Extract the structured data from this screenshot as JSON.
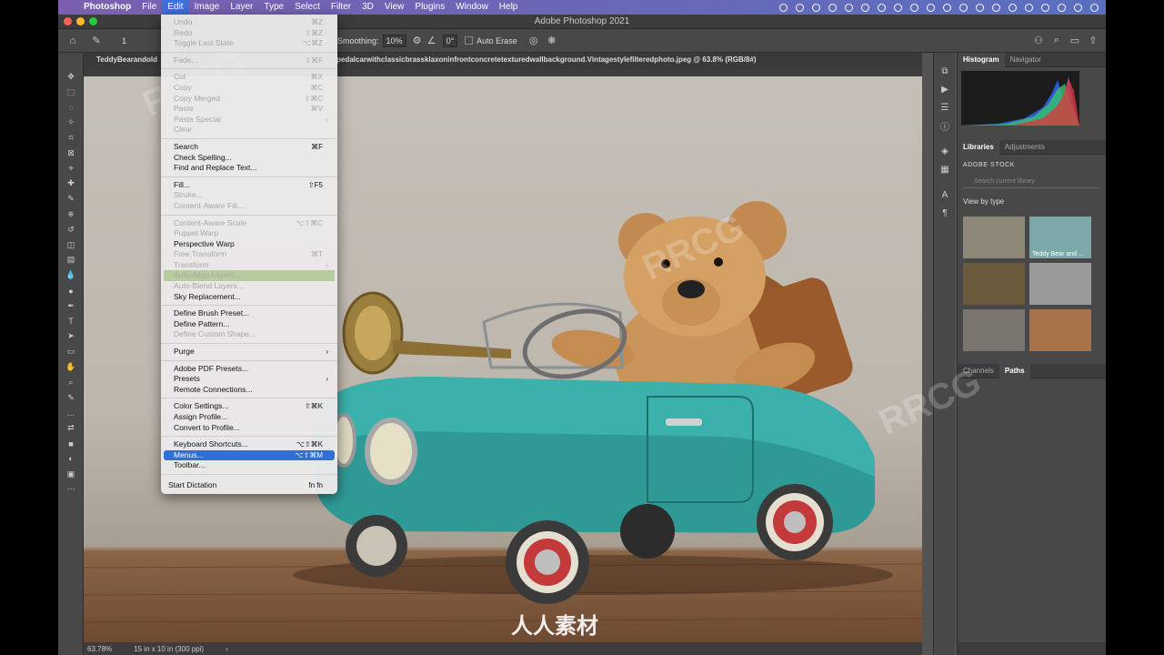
{
  "menubar": {
    "app": "Photoshop",
    "items": [
      "File",
      "Edit",
      "Image",
      "Layer",
      "Type",
      "Select",
      "Filter",
      "3D",
      "View",
      "Plugins",
      "Window",
      "Help"
    ],
    "active": "Edit"
  },
  "window": {
    "title": "Adobe Photoshop 2021"
  },
  "options": {
    "brush_size": "1",
    "smoothing_label": "Smoothing:",
    "smoothing_value": "10%",
    "angle": "0°",
    "auto_erase": "Auto Erase"
  },
  "document": {
    "tab_left": "TeddyBearandold",
    "tab_right": "pedalcarwithclassicbrassklaxoninfrontconcretetexturedwallbackground.Vintagestylefilteredphoto.jpeg @ 63.8% (RGB/8#)"
  },
  "status": {
    "zoom": "63.78%",
    "size": "15 in x 10 in (300 ppi)",
    "arrow": "›"
  },
  "edit_menu": [
    {
      "label": "Undo",
      "shortcut": "⌘Z",
      "disabled": true
    },
    {
      "label": "Redo",
      "shortcut": "⇧⌘Z",
      "disabled": true
    },
    {
      "label": "Toggle Last State",
      "shortcut": "⌥⌘Z",
      "disabled": true
    },
    {
      "sep": true
    },
    {
      "label": "Fade...",
      "shortcut": "⇧⌘F",
      "disabled": true
    },
    {
      "sep": true
    },
    {
      "label": "Cut",
      "shortcut": "⌘X",
      "disabled": true
    },
    {
      "label": "Copy",
      "shortcut": "⌘C",
      "disabled": true
    },
    {
      "label": "Copy Merged",
      "shortcut": "⇧⌘C",
      "disabled": true
    },
    {
      "label": "Paste",
      "shortcut": "⌘V",
      "disabled": true
    },
    {
      "label": "Paste Special",
      "shortcut": "›",
      "disabled": true,
      "sub": true
    },
    {
      "label": "Clear",
      "shortcut": "",
      "disabled": true
    },
    {
      "sep": true
    },
    {
      "label": "Search",
      "shortcut": "⌘F"
    },
    {
      "label": "Check Spelling...",
      "shortcut": ""
    },
    {
      "label": "Find and Replace Text...",
      "shortcut": ""
    },
    {
      "sep": true
    },
    {
      "label": "Fill...",
      "shortcut": "⇧F5"
    },
    {
      "label": "Stroke...",
      "shortcut": "",
      "disabled": true
    },
    {
      "label": "Content-Aware Fill...",
      "shortcut": "",
      "disabled": true
    },
    {
      "sep": true
    },
    {
      "label": "Content-Aware Scale",
      "shortcut": "⌥⇧⌘C",
      "disabled": true
    },
    {
      "label": "Puppet Warp",
      "shortcut": "",
      "disabled": true
    },
    {
      "label": "Perspective Warp",
      "shortcut": ""
    },
    {
      "label": "Free Transform",
      "shortcut": "⌘T",
      "disabled": true
    },
    {
      "label": "Transform",
      "shortcut": "›",
      "disabled": true,
      "sub": true
    },
    {
      "label": "Auto-Align Layers...",
      "shortcut": "",
      "disabled": true,
      "green": true
    },
    {
      "label": "Auto-Blend Layers...",
      "shortcut": "",
      "disabled": true
    },
    {
      "label": "Sky Replacement...",
      "shortcut": ""
    },
    {
      "sep": true
    },
    {
      "label": "Define Brush Preset...",
      "shortcut": ""
    },
    {
      "label": "Define Pattern...",
      "shortcut": ""
    },
    {
      "label": "Define Custom Shape...",
      "shortcut": "",
      "disabled": true
    },
    {
      "sep": true
    },
    {
      "label": "Purge",
      "shortcut": "›",
      "sub": true
    },
    {
      "sep": true
    },
    {
      "label": "Adobe PDF Presets...",
      "shortcut": ""
    },
    {
      "label": "Presets",
      "shortcut": "›",
      "sub": true
    },
    {
      "label": "Remote Connections...",
      "shortcut": ""
    },
    {
      "sep": true
    },
    {
      "label": "Color Settings...",
      "shortcut": "⇧⌘K"
    },
    {
      "label": "Assign Profile...",
      "shortcut": ""
    },
    {
      "label": "Convert to Profile...",
      "shortcut": ""
    },
    {
      "sep": true
    },
    {
      "label": "Keyboard Shortcuts...",
      "shortcut": "⌥⇧⌘K"
    },
    {
      "label": "Menus...",
      "shortcut": "⌥⇧⌘M",
      "highlight": true
    },
    {
      "label": "Toolbar...",
      "shortcut": ""
    },
    {
      "sep": true
    },
    {
      "label": "Start Dictation",
      "shortcut": "fn fn",
      "dict": true
    }
  ],
  "panels": {
    "top_tabs": [
      "Histogram",
      "Navigator"
    ],
    "lib_tabs": [
      "Libraries",
      "Adjustments"
    ],
    "library_name": "ADOBE STOCK",
    "search_placeholder": "Search current library",
    "view_by": "View by type",
    "thumb_label": "Teddy Bear and ...",
    "bottom_tabs": [
      "Channels",
      "Paths"
    ]
  },
  "watermark": "RRCG",
  "logo_text": "人人素材"
}
